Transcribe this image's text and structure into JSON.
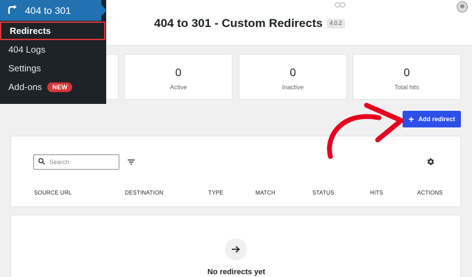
{
  "menu": {
    "title": "404 to 301",
    "items": [
      {
        "label": "Redirects",
        "active": true
      },
      {
        "label": "404 Logs"
      },
      {
        "label": "Settings"
      },
      {
        "label": "Add-ons",
        "badge": "NEW"
      }
    ]
  },
  "header": {
    "title": "404 to 301 - Custom Redirects",
    "version": "4.0.2"
  },
  "stats": [
    {
      "value": "0",
      "label": "Active"
    },
    {
      "value": "0",
      "label": "Inactive"
    },
    {
      "value": "0",
      "label": "Total hits"
    }
  ],
  "actions": {
    "add_redirect_label": "Add redirect"
  },
  "table": {
    "search_placeholder": "Search",
    "columns": [
      "SOURCE URL",
      "DESTINATION",
      "TYPE",
      "MATCH",
      "STATUS",
      "HITS",
      "ACTIONS"
    ]
  },
  "empty_state": {
    "message": "No redirects yet"
  },
  "colors": {
    "primary": "#2b50e8",
    "menu_bg": "#1d2327",
    "menu_head": "#2271b1",
    "annotation": "#e8001f"
  },
  "icons": [
    "redirect-icon",
    "link-icon",
    "avatar",
    "plus-icon",
    "search-icon",
    "filter-icon",
    "gear-icon",
    "arrow-right-icon"
  ]
}
